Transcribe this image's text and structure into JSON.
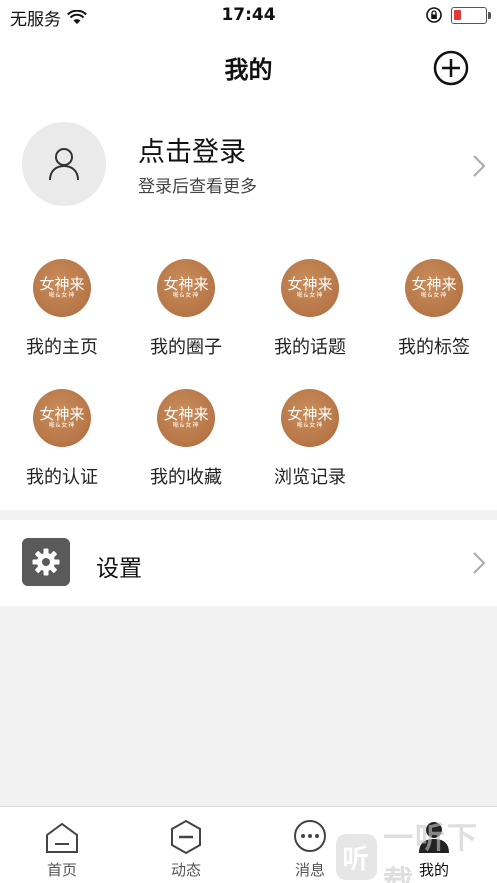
{
  "status_bar": {
    "carrier": "无服务",
    "time": "17:44",
    "battery_level": 0.22,
    "battery_color": "#e23a3a"
  },
  "nav": {
    "title": "我的",
    "add_icon": "plus-circle-icon"
  },
  "profile": {
    "title": "点击登录",
    "subtitle": "登录后查看更多",
    "avatar_icon": "user-icon"
  },
  "logo": {
    "main": "女神来",
    "sub": "啪&女神"
  },
  "grid": {
    "items": [
      {
        "label": "我的主页"
      },
      {
        "label": "我的圈子"
      },
      {
        "label": "我的话题"
      },
      {
        "label": "我的标签"
      },
      {
        "label": "我的认证"
      },
      {
        "label": "我的收藏"
      },
      {
        "label": "浏览记录"
      }
    ]
  },
  "settings": {
    "label": "设置",
    "icon": "gear-icon"
  },
  "tabs": [
    {
      "label": "首页",
      "icon": "home-icon"
    },
    {
      "label": "动态",
      "icon": "dynamic-icon"
    },
    {
      "label": "消息",
      "icon": "message-icon"
    },
    {
      "label": "我的",
      "icon": "profile-icon",
      "active": true
    }
  ],
  "watermark": {
    "icon_text": "听",
    "text": "一听下载"
  }
}
